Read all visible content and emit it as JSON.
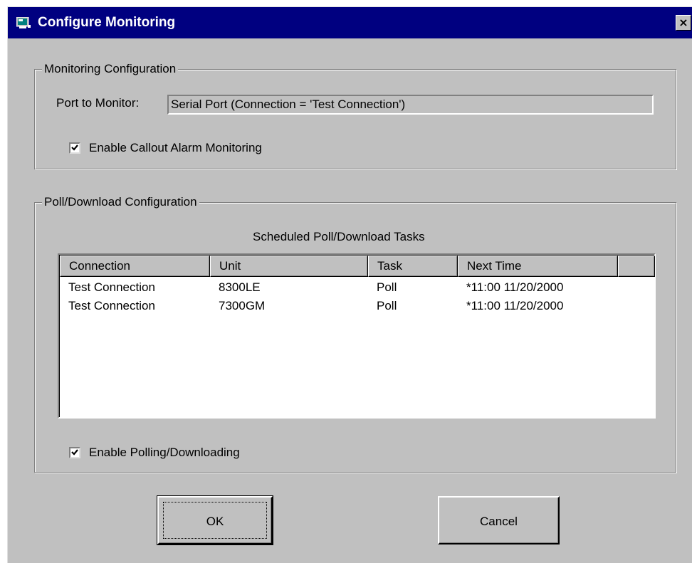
{
  "window": {
    "title": "Configure Monitoring",
    "close_label": "×",
    "icon": "monitor-app-icon"
  },
  "monitoring": {
    "legend": "Monitoring Configuration",
    "port_label": "Port to Monitor:",
    "port_value": "Serial Port (Connection = 'Test Connection')",
    "alarm_checkbox_label": "Enable Callout Alarm Monitoring",
    "alarm_checked": true
  },
  "poll": {
    "legend": "Poll/Download Configuration",
    "list_caption": "Scheduled Poll/Download Tasks",
    "columns": [
      "Connection",
      "Unit",
      "Task",
      "Next Time"
    ],
    "rows": [
      [
        "Test Connection",
        "8300LE",
        "Poll",
        "*11:00 11/20/2000"
      ],
      [
        "Test Connection",
        "7300GM",
        "Poll",
        "*11:00 11/20/2000"
      ]
    ],
    "enable_checkbox_label": "Enable Polling/Downloading",
    "enable_checked": true
  },
  "buttons": {
    "ok": "OK",
    "cancel": "Cancel"
  }
}
